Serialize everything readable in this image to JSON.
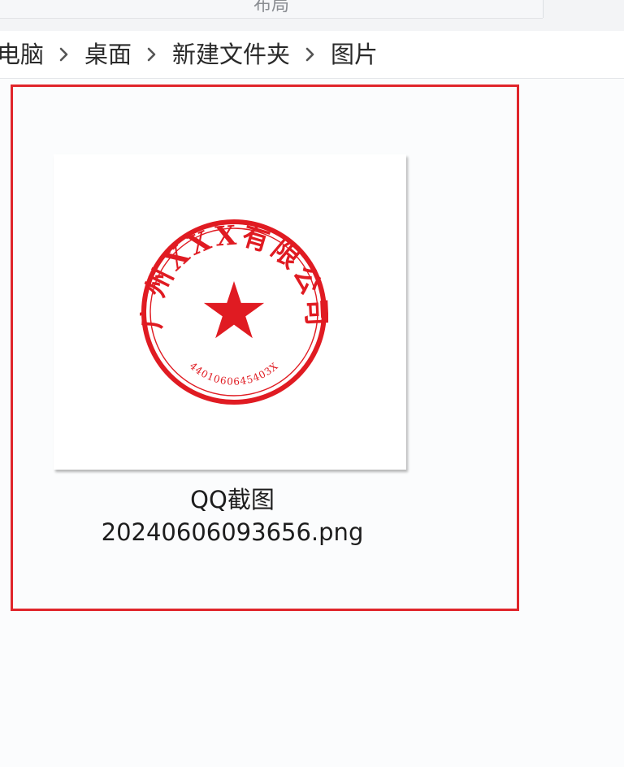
{
  "window": {
    "tab_fragment": "布局"
  },
  "breadcrumb": {
    "items": [
      "电脑",
      "桌面",
      "新建文件夹",
      "图片"
    ]
  },
  "file": {
    "name_line1": "QQ截图",
    "name_line2": "20240606093656.png",
    "selected": true
  },
  "stamp": {
    "company_text": "广州XXX有限公司",
    "serial_number": "4401060645403X",
    "color": "#e01b22"
  },
  "colors": {
    "selection_border": "#e0252b"
  }
}
